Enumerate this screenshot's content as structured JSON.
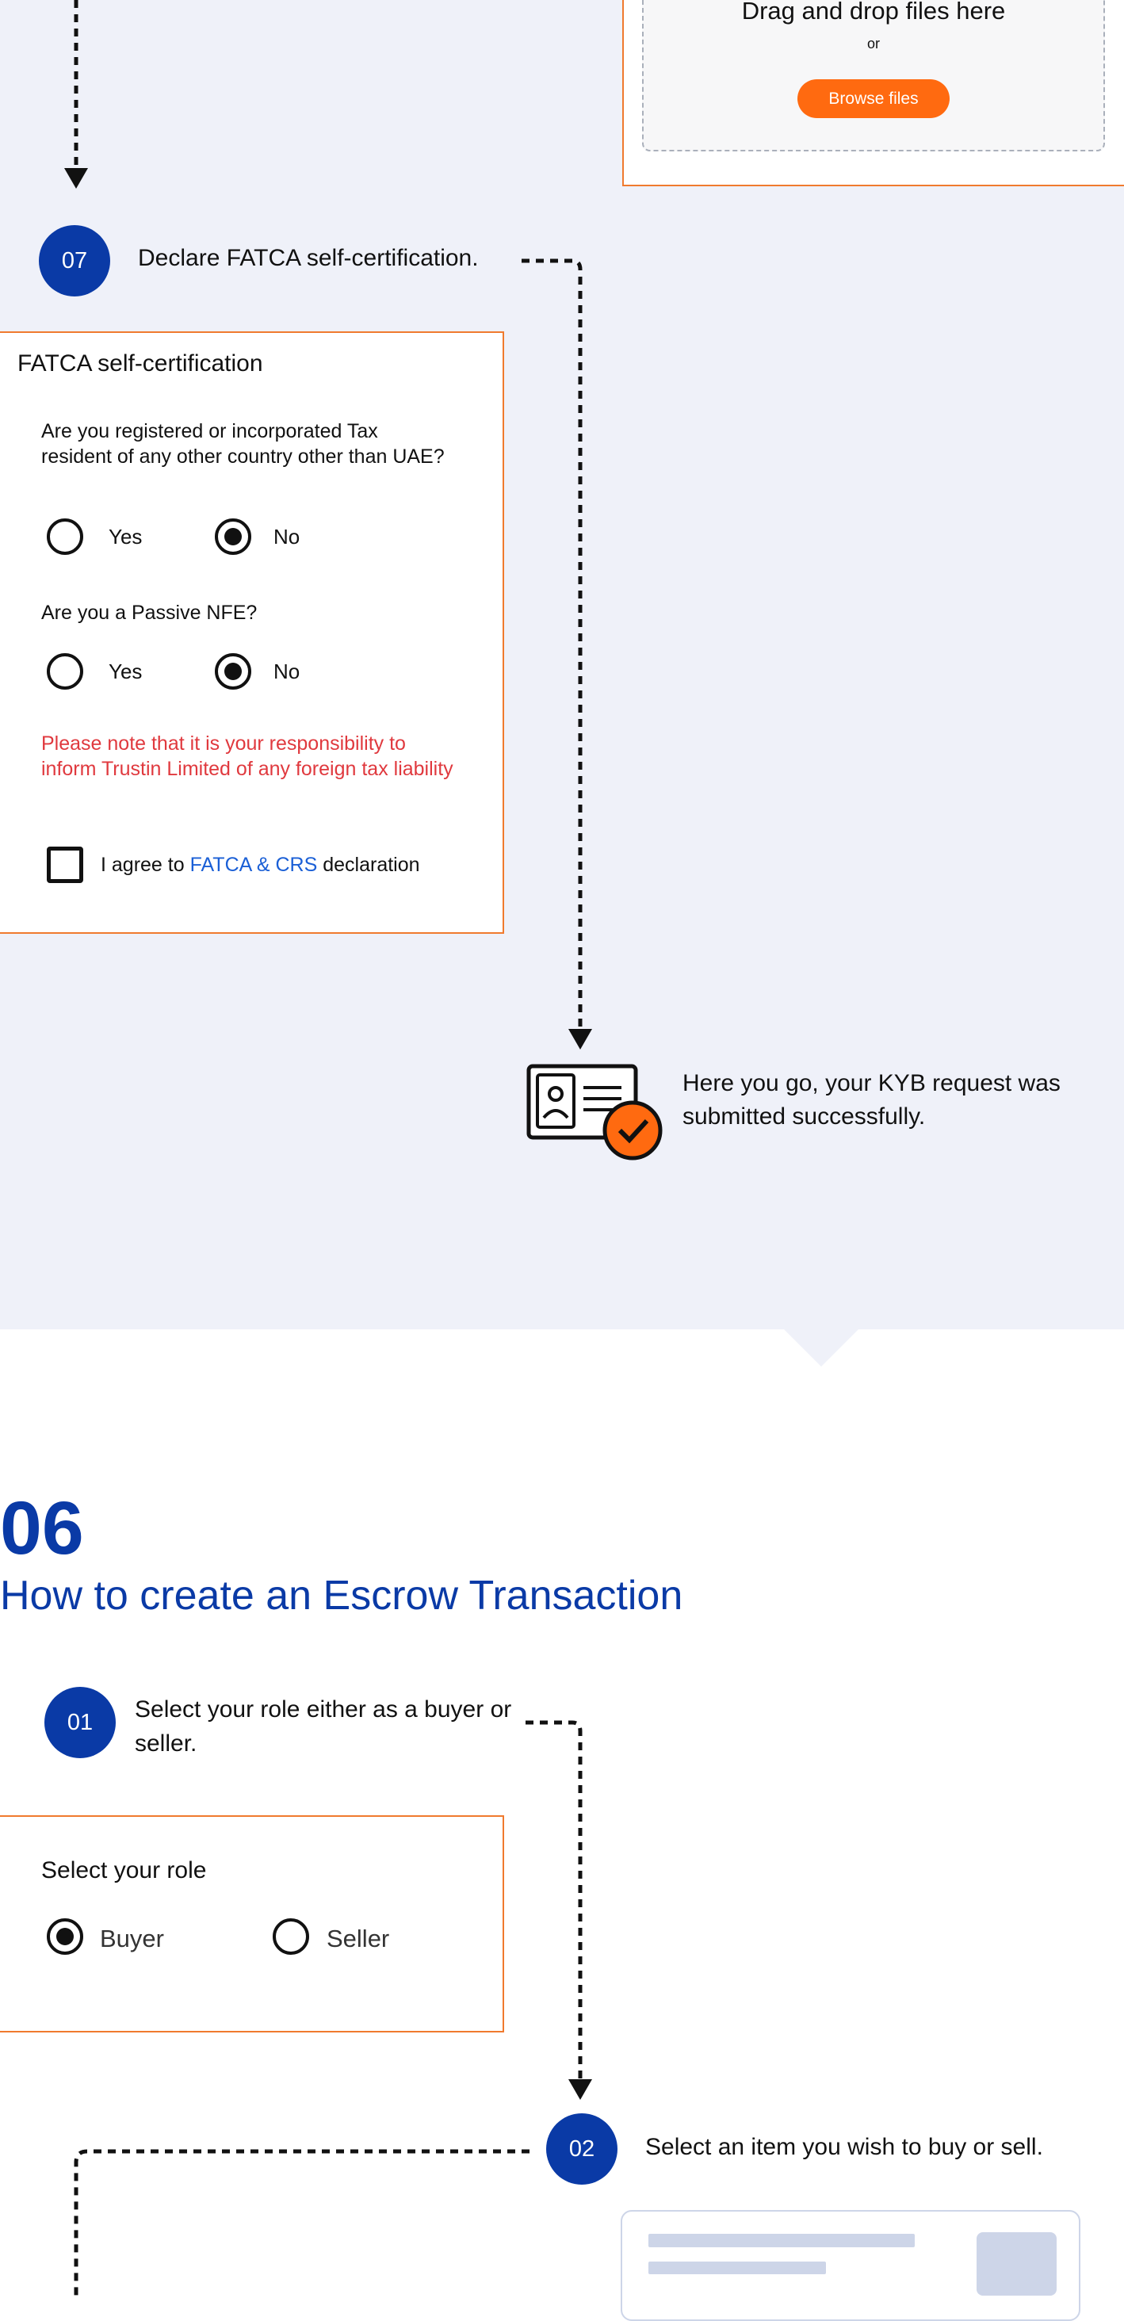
{
  "upload": {
    "drop_text": "Drag and drop files here",
    "or_text": "or",
    "browse_label": "Browse files"
  },
  "kyb": {
    "step07": {
      "number": "07",
      "text": "Declare FATCA self-certification."
    },
    "fatca": {
      "title": "FATCA self-certification",
      "q1": "Are you registered or incorporated Tax resident of any other country other than UAE?",
      "q1_yes": "Yes",
      "q1_no": "No",
      "q2": "Are you a Passive NFE?",
      "q2_yes": "Yes",
      "q2_no": "No",
      "notice": "Please note that it is your responsibility to inform Trustin Limited of any foreign tax liability",
      "agree_prefix": "I agree to",
      "agree_link": "FATCA & CRS",
      "agree_suffix": "declaration"
    },
    "success_text": "Here you go, your KYB request was submitted successfully."
  },
  "section06": {
    "number": "06",
    "title": "How to create an Escrow Transaction",
    "step01": {
      "number": "01",
      "text": "Select your role either as a buyer or seller."
    },
    "role_card": {
      "title": "Select your role",
      "buyer": "Buyer",
      "seller": "Seller"
    },
    "step02": {
      "number": "02",
      "text": "Select an item you wish to buy or sell."
    }
  },
  "colors": {
    "brand_blue": "#0a3aa6",
    "accent_orange": "#ff6a10",
    "card_border": "#f07a2e",
    "warning_red": "#e0393e",
    "link_blue": "#1a5fd6",
    "band_background": "#eff1f9"
  },
  "icons": {
    "kyb_success": "id-card-check-icon",
    "arrow": "arrow-down-icon"
  }
}
